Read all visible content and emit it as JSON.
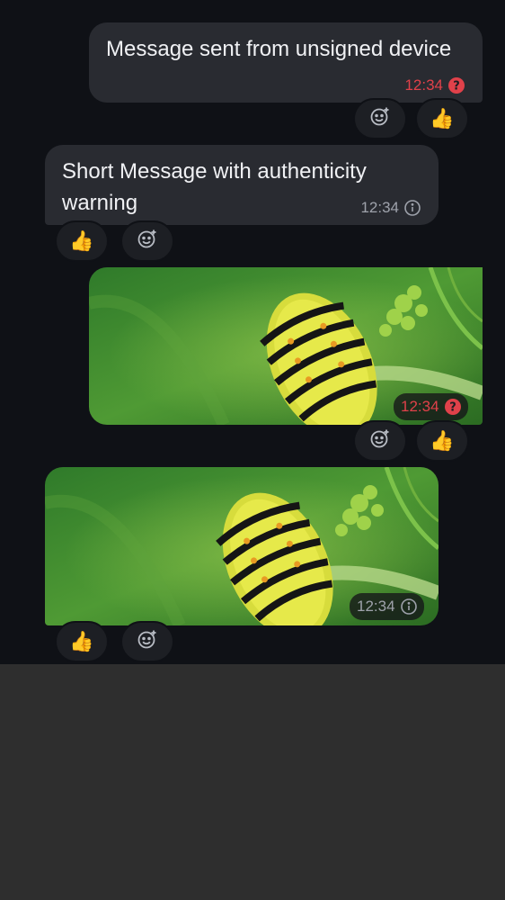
{
  "messages": [
    {
      "kind": "text",
      "direction": "outgoing",
      "text": "Message sent from unsigned device",
      "time": "12:34",
      "status_icon": "question-circle-icon",
      "status_color": "#e0414a",
      "reactions": [
        "add-reaction-icon",
        "👍"
      ]
    },
    {
      "kind": "text",
      "direction": "incoming",
      "text": "Short Message with authenticity warning",
      "time": "12:34",
      "status_icon": "info-circle-icon",
      "status_color": "#9ea2ab",
      "reactions": [
        "👍",
        "add-reaction-icon"
      ]
    },
    {
      "kind": "image",
      "direction": "outgoing",
      "image_subject": "caterpillar-photo",
      "time": "12:34",
      "status_icon": "question-circle-icon",
      "status_color": "#e0414a",
      "reactions": [
        "add-reaction-icon",
        "👍"
      ]
    },
    {
      "kind": "image",
      "direction": "incoming",
      "image_subject": "caterpillar-photo",
      "time": "12:34",
      "status_icon": "info-circle-icon",
      "status_color": "#9ea2ab",
      "reactions": [
        "👍",
        "add-reaction-icon"
      ]
    }
  ],
  "colors": {
    "chat_background": "#0f1116",
    "bubble": "#292b31",
    "warning": "#e0414a",
    "muted": "#9ea2ab",
    "below_chat": "#2e2e2e"
  }
}
